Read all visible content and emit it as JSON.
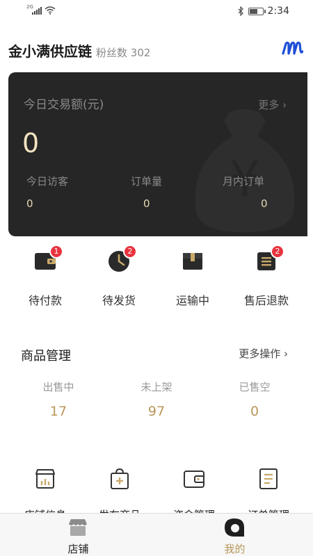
{
  "status_bar": {
    "network": "2G",
    "time": "2:34",
    "icons": [
      "signal-icon",
      "wifi-icon",
      "bluetooth-icon",
      "battery-icon"
    ]
  },
  "header": {
    "shop_name": "金小满供应链",
    "fans_label": "粉丝数",
    "fans_count": "302",
    "logo": "brand-m-logo"
  },
  "dashboard": {
    "title": "今日交易额(元)",
    "more": "更多 ›",
    "amount": "0",
    "stats": [
      {
        "label": "今日访客",
        "value": "0"
      },
      {
        "label": "订单量",
        "value": "0"
      },
      {
        "label": "月内订单",
        "value": "0"
      }
    ]
  },
  "orders": [
    {
      "label": "待付款",
      "badge": "1",
      "icon": "wallet-icon"
    },
    {
      "label": "待发货",
      "badge": "2",
      "icon": "clock-icon"
    },
    {
      "label": "运输中",
      "badge": "",
      "icon": "box-icon"
    },
    {
      "label": "售后退款",
      "badge": "2",
      "icon": "document-icon"
    }
  ],
  "products": {
    "title": "商品管理",
    "more": "更多操作 ›",
    "stats": [
      {
        "label": "出售中",
        "value": "17"
      },
      {
        "label": "未上架",
        "value": "97"
      },
      {
        "label": "已售空",
        "value": "0"
      }
    ]
  },
  "tools": [
    {
      "label": "店铺信息",
      "icon": "store-icon"
    },
    {
      "label": "发布商品",
      "icon": "shopping-bag-plus-icon"
    },
    {
      "label": "资金管理",
      "icon": "wallet-outline-icon"
    },
    {
      "label": "订单管理",
      "icon": "order-list-icon"
    }
  ],
  "tabbar": [
    {
      "label": "店铺",
      "icon": "shop-tab-icon"
    },
    {
      "label": "我的",
      "icon": "profile-tab-icon"
    }
  ],
  "colors": {
    "accent_gold": "#b8975a",
    "card_bg": "#262626",
    "badge_red": "#e8333f",
    "brand_blue": "#1f4fd6"
  }
}
